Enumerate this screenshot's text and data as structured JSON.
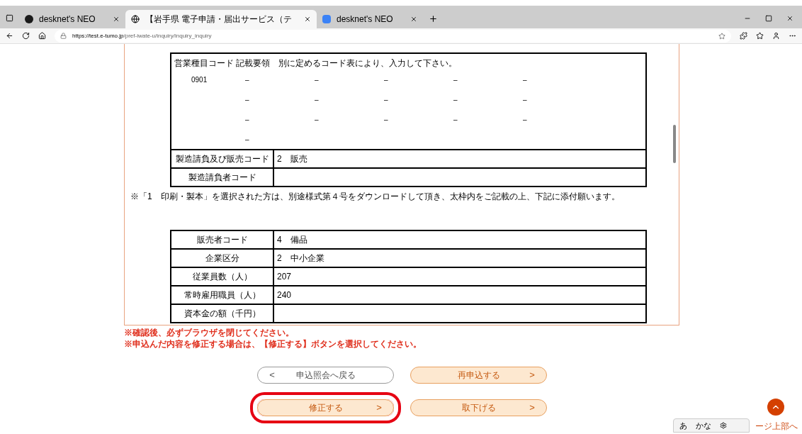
{
  "browser": {
    "tabs": [
      {
        "title": "desknet's NEO",
        "selected": false
      },
      {
        "title": "【岩手県 電子申請・届出サービス（テ",
        "selected": true
      },
      {
        "title": "desknet's NEO",
        "selected": false
      }
    ],
    "address": {
      "host": "https://test.e-tumo.jp",
      "path": "/pref-iwate-u/inquiry/inquiry_inquiry"
    }
  },
  "code_section": {
    "heading": "営業種目コード 記載要領　別に定めるコード表により、入力して下さい。",
    "rows": [
      {
        "code": "0901",
        "cells": [
          "–",
          "–",
          "–",
          "–",
          "–"
        ]
      },
      {
        "cells": [
          "–",
          "–",
          "–",
          "–",
          "–"
        ]
      },
      {
        "cells": [
          "–",
          "–",
          "–",
          "–",
          "–"
        ]
      },
      {
        "cells": [
          "–"
        ]
      }
    ]
  },
  "table1": [
    {
      "label": "製造請負及び販売コード",
      "value": "2　販売"
    },
    {
      "label": "製造請負者コード"
    }
  ],
  "note": "※「1　印刷・製本」を選択された方は、別途様式第４号をダウンロードして頂き、太枠内をご記載の上、下記に添付願います。",
  "table2": [
    {
      "label": "販売者コード",
      "value": "4　備品"
    },
    {
      "label": "企業区分",
      "value": "2　中小企業"
    },
    {
      "label": "従業員数（人）",
      "value": "207"
    },
    {
      "label": "常時雇用職員（人）",
      "value": "240"
    },
    {
      "label": "資本金の額（千円）"
    }
  ],
  "warnings": [
    "※確認後、必ずブラウザを閉じてください。",
    "※申込んだ内容を修正する場合は、【修正する】ボタンを選択してください。"
  ],
  "buttons": [
    {
      "label": "申込照会へ戻る",
      "kind": "back",
      "highlighted": false,
      "arrow": "<"
    },
    {
      "label": "再申込する",
      "kind": "forward",
      "highlighted": false,
      "arrow": ">"
    },
    {
      "label": "修正する",
      "kind": "forward",
      "highlighted": true,
      "arrow": ">"
    },
    {
      "label": "取下げる",
      "kind": "forward",
      "highlighted": false,
      "arrow": ">"
    }
  ],
  "page_top": {
    "label": "ージ上部へ"
  },
  "ime": {
    "items": [
      "あ",
      "かな"
    ]
  }
}
